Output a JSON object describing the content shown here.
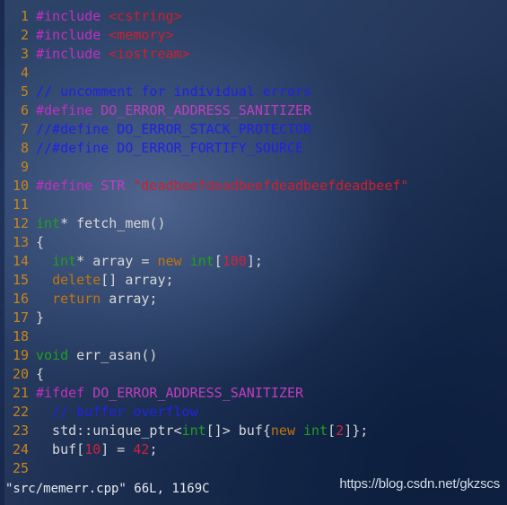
{
  "editor": {
    "name": "vim-terminal",
    "first_line_number": 1,
    "colors": {
      "background": "#26395d",
      "line_number": "#c8851a",
      "preprocessor": "#c22fc2",
      "macro_name": "#bd3fbd",
      "include_header": "#cf1f2e",
      "string": "#cf1f2e",
      "comment": "#2222e2",
      "type_keyword": "#1ea01e",
      "keyword": "#c0750f",
      "number": "#d1213b",
      "plain_text": "#d8d8d8",
      "status_text": "#e6e9ee"
    },
    "lines": [
      {
        "n": "1",
        "tokens": [
          {
            "t": "#include ",
            "c": "tk-pre"
          },
          {
            "t": "<cstring>",
            "c": "tk-inc"
          }
        ]
      },
      {
        "n": "2",
        "tokens": [
          {
            "t": "#include ",
            "c": "tk-pre"
          },
          {
            "t": "<memory>",
            "c": "tk-inc"
          }
        ]
      },
      {
        "n": "3",
        "tokens": [
          {
            "t": "#include ",
            "c": "tk-pre"
          },
          {
            "t": "<iostream>",
            "c": "tk-inc"
          }
        ]
      },
      {
        "n": "4",
        "tokens": []
      },
      {
        "n": "5",
        "tokens": [
          {
            "t": "// uncomment for individual errors",
            "c": "tk-cmt"
          }
        ]
      },
      {
        "n": "6",
        "tokens": [
          {
            "t": "#define ",
            "c": "tk-pre"
          },
          {
            "t": "DO_ERROR_ADDRESS_SANITIZER",
            "c": "tk-macro"
          }
        ]
      },
      {
        "n": "7",
        "tokens": [
          {
            "t": "//#define DO_ERROR_STACK_PROTECTOR",
            "c": "tk-cmt"
          }
        ]
      },
      {
        "n": "8",
        "tokens": [
          {
            "t": "//#define DO_ERROR_FORTIFY_SOURCE",
            "c": "tk-cmt"
          }
        ]
      },
      {
        "n": "9",
        "tokens": []
      },
      {
        "n": "10",
        "tokens": [
          {
            "t": "#define ",
            "c": "tk-pre"
          },
          {
            "t": "STR ",
            "c": "tk-macro"
          },
          {
            "t": "\"deadbeefdeadbeefdeadbeefdeadbeef\"",
            "c": "tk-str"
          }
        ]
      },
      {
        "n": "11",
        "tokens": []
      },
      {
        "n": "12",
        "tokens": [
          {
            "t": "int",
            "c": "tk-type"
          },
          {
            "t": "* fetch_mem()",
            "c": "tk-plain"
          }
        ]
      },
      {
        "n": "13",
        "tokens": [
          {
            "t": "{",
            "c": "tk-plain"
          }
        ]
      },
      {
        "n": "14",
        "tokens": [
          {
            "t": "  ",
            "c": "tk-plain"
          },
          {
            "t": "int",
            "c": "tk-type"
          },
          {
            "t": "* array = ",
            "c": "tk-plain"
          },
          {
            "t": "new",
            "c": "tk-kw"
          },
          {
            "t": " ",
            "c": "tk-plain"
          },
          {
            "t": "int",
            "c": "tk-type"
          },
          {
            "t": "[",
            "c": "tk-plain"
          },
          {
            "t": "100",
            "c": "tk-num"
          },
          {
            "t": "];",
            "c": "tk-plain"
          }
        ]
      },
      {
        "n": "15",
        "tokens": [
          {
            "t": "  ",
            "c": "tk-plain"
          },
          {
            "t": "delete",
            "c": "tk-kw"
          },
          {
            "t": "[] array;",
            "c": "tk-plain"
          }
        ]
      },
      {
        "n": "16",
        "tokens": [
          {
            "t": "  ",
            "c": "tk-plain"
          },
          {
            "t": "return",
            "c": "tk-kw"
          },
          {
            "t": " array;",
            "c": "tk-plain"
          }
        ]
      },
      {
        "n": "17",
        "tokens": [
          {
            "t": "}",
            "c": "tk-plain"
          }
        ]
      },
      {
        "n": "18",
        "tokens": []
      },
      {
        "n": "19",
        "tokens": [
          {
            "t": "void",
            "c": "tk-type"
          },
          {
            "t": " err_asan()",
            "c": "tk-plain"
          }
        ]
      },
      {
        "n": "20",
        "tokens": [
          {
            "t": "{",
            "c": "tk-plain"
          }
        ]
      },
      {
        "n": "21",
        "tokens": [
          {
            "t": "#ifdef ",
            "c": "tk-pre"
          },
          {
            "t": "DO_ERROR_ADDRESS_SANITIZER",
            "c": "tk-macro"
          }
        ]
      },
      {
        "n": "22",
        "tokens": [
          {
            "t": "  ",
            "c": "tk-plain"
          },
          {
            "t": "// buffer overflow",
            "c": "tk-cmt"
          }
        ]
      },
      {
        "n": "23",
        "tokens": [
          {
            "t": "  std::unique_ptr<",
            "c": "tk-plain"
          },
          {
            "t": "int",
            "c": "tk-type"
          },
          {
            "t": "[]> buf{",
            "c": "tk-plain"
          },
          {
            "t": "new",
            "c": "tk-kw"
          },
          {
            "t": " ",
            "c": "tk-plain"
          },
          {
            "t": "int",
            "c": "tk-type"
          },
          {
            "t": "[",
            "c": "tk-plain"
          },
          {
            "t": "2",
            "c": "tk-num"
          },
          {
            "t": "]};",
            "c": "tk-plain"
          }
        ]
      },
      {
        "n": "24",
        "tokens": [
          {
            "t": "  buf[",
            "c": "tk-plain"
          },
          {
            "t": "10",
            "c": "tk-num"
          },
          {
            "t": "] = ",
            "c": "tk-plain"
          },
          {
            "t": "42",
            "c": "tk-num"
          },
          {
            "t": ";",
            "c": "tk-plain"
          }
        ]
      },
      {
        "n": "25",
        "tokens": []
      }
    ]
  },
  "statusline": {
    "text": "\"src/memerr.cpp\" 66L, 1169C",
    "filename": "src/memerr.cpp",
    "line_count": "66L",
    "char_count": "1169C"
  },
  "watermark": {
    "text": "https://blog.csdn.net/gkzscs"
  }
}
